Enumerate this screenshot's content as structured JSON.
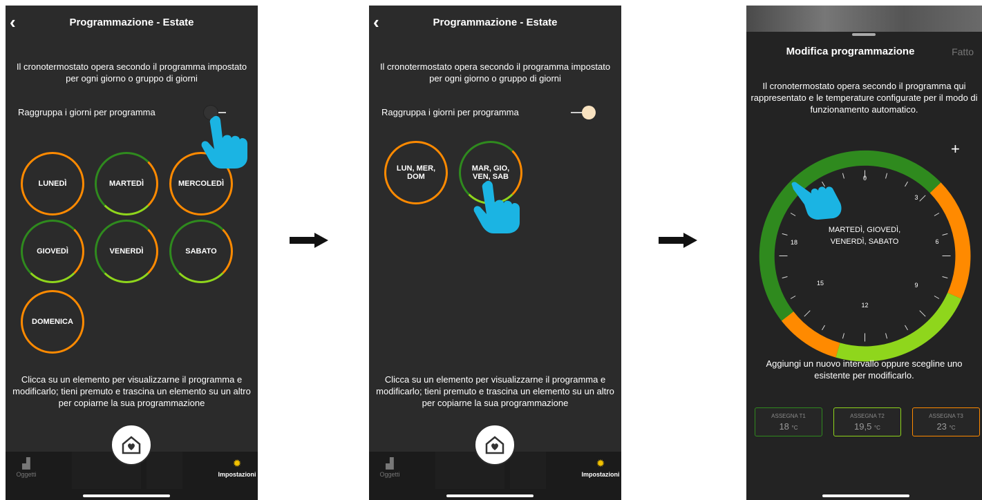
{
  "panel1": {
    "title": "Programmazione - Estate",
    "description": "Il cronotermostato opera secondo il programma impostato per ogni giorno o gruppo di giorni",
    "group_label": "Raggruppa i giorni per programma",
    "days": [
      "LUNEDÌ",
      "MARTEDÌ",
      "MERCOLEDÌ",
      "GIOVEDÌ",
      "VENERDÌ",
      "SABATO",
      "DOMENICA"
    ],
    "hint": "Clicca su un elemento per visualizzarne il programma e modificarlo; tieni premuto e trascina un elemento su un altro per copiarne la sua programmazione",
    "tab_objects": "Oggetti",
    "tab_settings": "Impostazioni"
  },
  "panel2": {
    "title": "Programmazione - Estate",
    "description": "Il cronotermostato opera secondo il programma impostato per ogni giorno o gruppo di giorni",
    "group_label": "Raggruppa i giorni per programma",
    "groups": [
      "LUN, MER, DOM",
      "MAR, GIO, VEN, SAB"
    ],
    "hint": "Clicca su un elemento per visualizzarne il programma e modificarlo; tieni premuto e trascina un elemento su un altro per copiarne la sua programmazione",
    "tab_objects": "Oggetti",
    "tab_settings": "Impostazioni"
  },
  "panel3": {
    "title": "Modifica programmazione",
    "done": "Fatto",
    "description": "Il cronotermostato opera secondo il programma qui rappresentato e le temperature configurate per il modo di funzionamento automatico.",
    "dial_center": "MARTEDÌ, GIOVEDÌ, VENERDÌ, SABATO",
    "dial_hours": [
      "0",
      "3",
      "6",
      "9",
      "12",
      "15",
      "18"
    ],
    "hint": "Aggiungi un nuovo intervallo oppure scegline uno esistente per modificarlo.",
    "buttons": [
      {
        "label": "ASSEGNA T1",
        "value": "18",
        "unit": "°C",
        "color": "#2f8a1e"
      },
      {
        "label": "ASSEGNA T2",
        "value": "19,5",
        "unit": "°C",
        "color": "#8fd61c"
      },
      {
        "label": "ASSEGNA T3",
        "value": "23",
        "unit": "°C",
        "color": "#ff8a00"
      }
    ]
  },
  "colors": {
    "orange": "#ff8a00",
    "dark_green": "#2f8a1e",
    "light_green": "#8fd61c",
    "hand": "#1bb4e3"
  }
}
